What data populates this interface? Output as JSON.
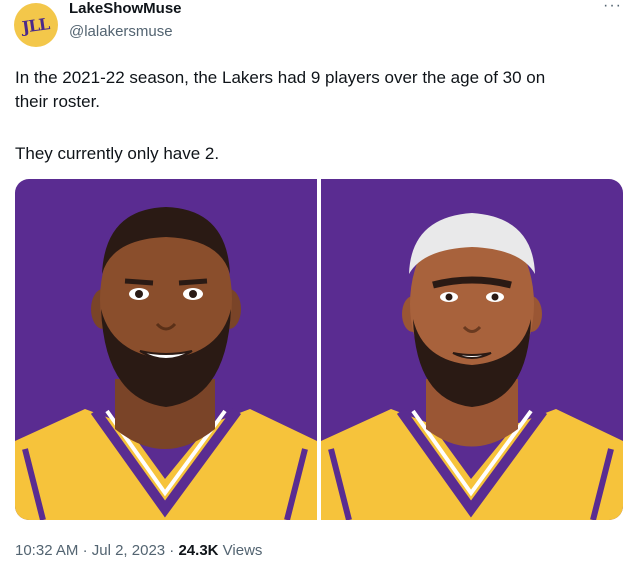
{
  "author": {
    "avatar_text": "JLL",
    "name": "LakeShowMuse",
    "handle": "@lalakersmuse"
  },
  "menu": {
    "label": "···"
  },
  "tweet": {
    "line1": "In the 2021-22 season, the Lakers had 9 players over the age of 30 on",
    "line2": "their roster.",
    "line3": "They currently only have 2."
  },
  "media": {
    "images": [
      {
        "description": "cartoon-player-1",
        "jersey_color": "#f6c33b",
        "background": "#5a2c91"
      },
      {
        "description": "cartoon-player-2",
        "jersey_color": "#f6c33b",
        "background": "#5a2c91"
      }
    ]
  },
  "footer": {
    "time": "10:32 AM",
    "date": "Jul 2, 2023",
    "views_count": "24.3K",
    "views_label": "Views"
  }
}
